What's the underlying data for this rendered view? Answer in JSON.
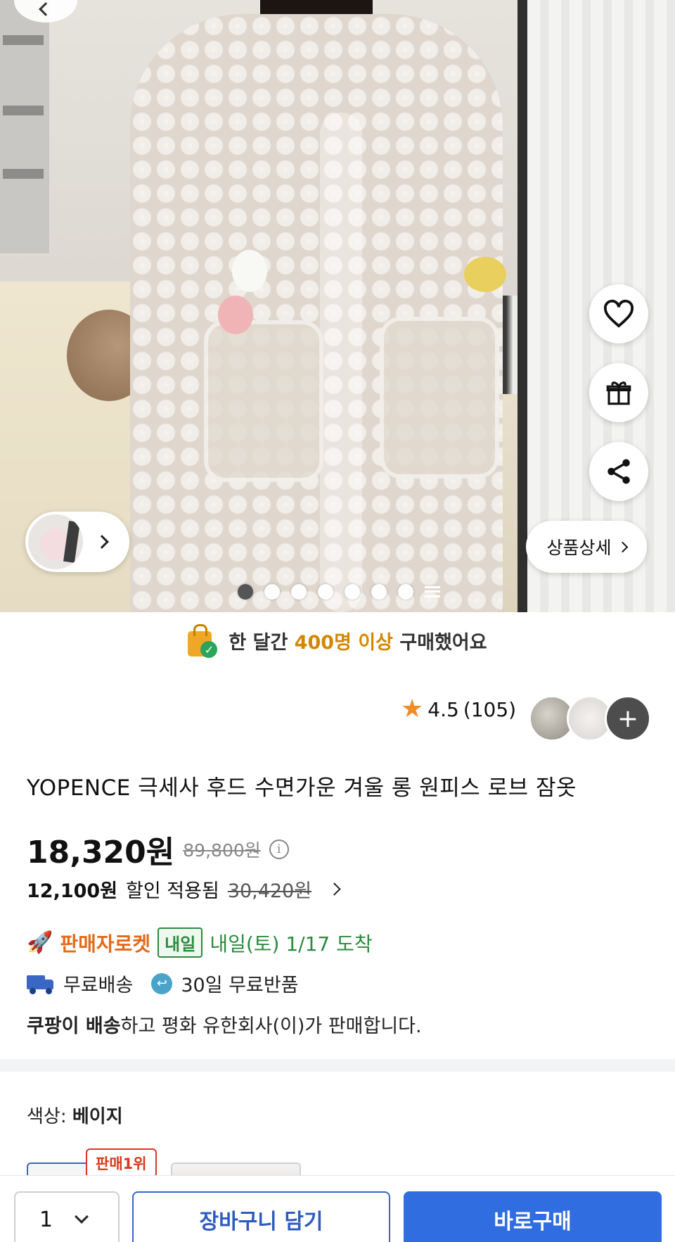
{
  "gallery": {
    "detail_label": "상품상세",
    "dot_count": 7,
    "active_dot": 0
  },
  "social_proof": {
    "prefix": "한 달간",
    "highlight": "400명 이상",
    "suffix": "구매했어요",
    "highlight_color": "#d38700"
  },
  "rating": {
    "score": "4.5",
    "count": "(105)",
    "more_icon": "+"
  },
  "product": {
    "title": "YOPENCE 극세사 후드 수면가운 겨울 롱 원피스 로브 잠옷"
  },
  "price": {
    "current": "18,320원",
    "original": "89,800원"
  },
  "coupon": {
    "price": "12,100원",
    "label": "할인 적용됨",
    "original": "30,420원"
  },
  "delivery": {
    "rocket_label": "판매자로켓",
    "badge": "내일",
    "arrival": "내일(토) 1/17 도착",
    "free_shipping": "무료배송",
    "free_return": "30일 무료반품"
  },
  "seller": {
    "bold": "쿠팡이 배송",
    "rest": "하고 평화 유한회사(이)가 판매합니다."
  },
  "option": {
    "label": "색상:",
    "value": "베이지",
    "rank_badge": "판매1위"
  },
  "bottom_bar": {
    "quantity": "1",
    "cart_label": "장바구니 담기",
    "buy_label": "바로구매",
    "accent": "#2f6de0"
  }
}
